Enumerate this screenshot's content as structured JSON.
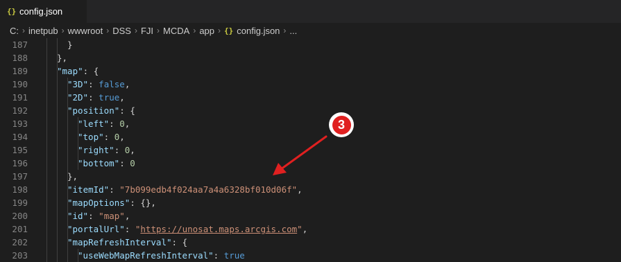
{
  "tab": {
    "icon": "{}",
    "label": "config.json"
  },
  "breadcrumb": {
    "parts": [
      "C:",
      "inetpub",
      "wwwroot",
      "DSS",
      "FJI",
      "MCDA",
      "app"
    ],
    "file_icon": "{}",
    "file": "config.json",
    "more": "..."
  },
  "editor": {
    "lines": [
      {
        "n": "187"
      },
      {
        "n": "188"
      },
      {
        "n": "189"
      },
      {
        "n": "190"
      },
      {
        "n": "191"
      },
      {
        "n": "192"
      },
      {
        "n": "193"
      },
      {
        "n": "194"
      },
      {
        "n": "195"
      },
      {
        "n": "196"
      },
      {
        "n": "197"
      },
      {
        "n": "198"
      },
      {
        "n": "199"
      },
      {
        "n": "200"
      },
      {
        "n": "201"
      },
      {
        "n": "202"
      },
      {
        "n": "203"
      }
    ],
    "tokens": {
      "l187": "}",
      "l188": "},",
      "l189_key": "\"map\"",
      "l189_rest": ": {",
      "l190_key": "\"3D\"",
      "l190_p": ": ",
      "l190_val": "false",
      "l190_c": ",",
      "l191_key": "\"2D\"",
      "l191_p": ": ",
      "l191_val": "true",
      "l191_c": ",",
      "l192_key": "\"position\"",
      "l192_rest": ": {",
      "l193_key": "\"left\"",
      "l193_p": ": ",
      "l193_val": "0",
      "l193_c": ",",
      "l194_key": "\"top\"",
      "l194_p": ": ",
      "l194_val": "0",
      "l194_c": ",",
      "l195_key": "\"right\"",
      "l195_p": ": ",
      "l195_val": "0",
      "l195_c": ",",
      "l196_key": "\"bottom\"",
      "l196_p": ": ",
      "l196_val": "0",
      "l197": "},",
      "l198_key": "\"itemId\"",
      "l198_p": ": ",
      "l198_val": "\"7b099edb4f024aa7a4a6328bf010d06f\"",
      "l198_c": ",",
      "l199_key": "\"mapOptions\"",
      "l199_rest": ": {},",
      "l200_key": "\"id\"",
      "l200_p": ": ",
      "l200_val": "\"map\"",
      "l200_c": ",",
      "l201_key": "\"portalUrl\"",
      "l201_p": ": ",
      "l201_q1": "\"",
      "l201_url": "https://unosat.maps.arcgis.com",
      "l201_q2": "\"",
      "l201_c": ",",
      "l202_key": "\"mapRefreshInterval\"",
      "l202_rest": ": {",
      "l203_key": "\"useWebMapRefreshInterval\"",
      "l203_p": ": ",
      "l203_val": "true"
    }
  },
  "annotation": {
    "label": "3",
    "color": "#e02020"
  }
}
